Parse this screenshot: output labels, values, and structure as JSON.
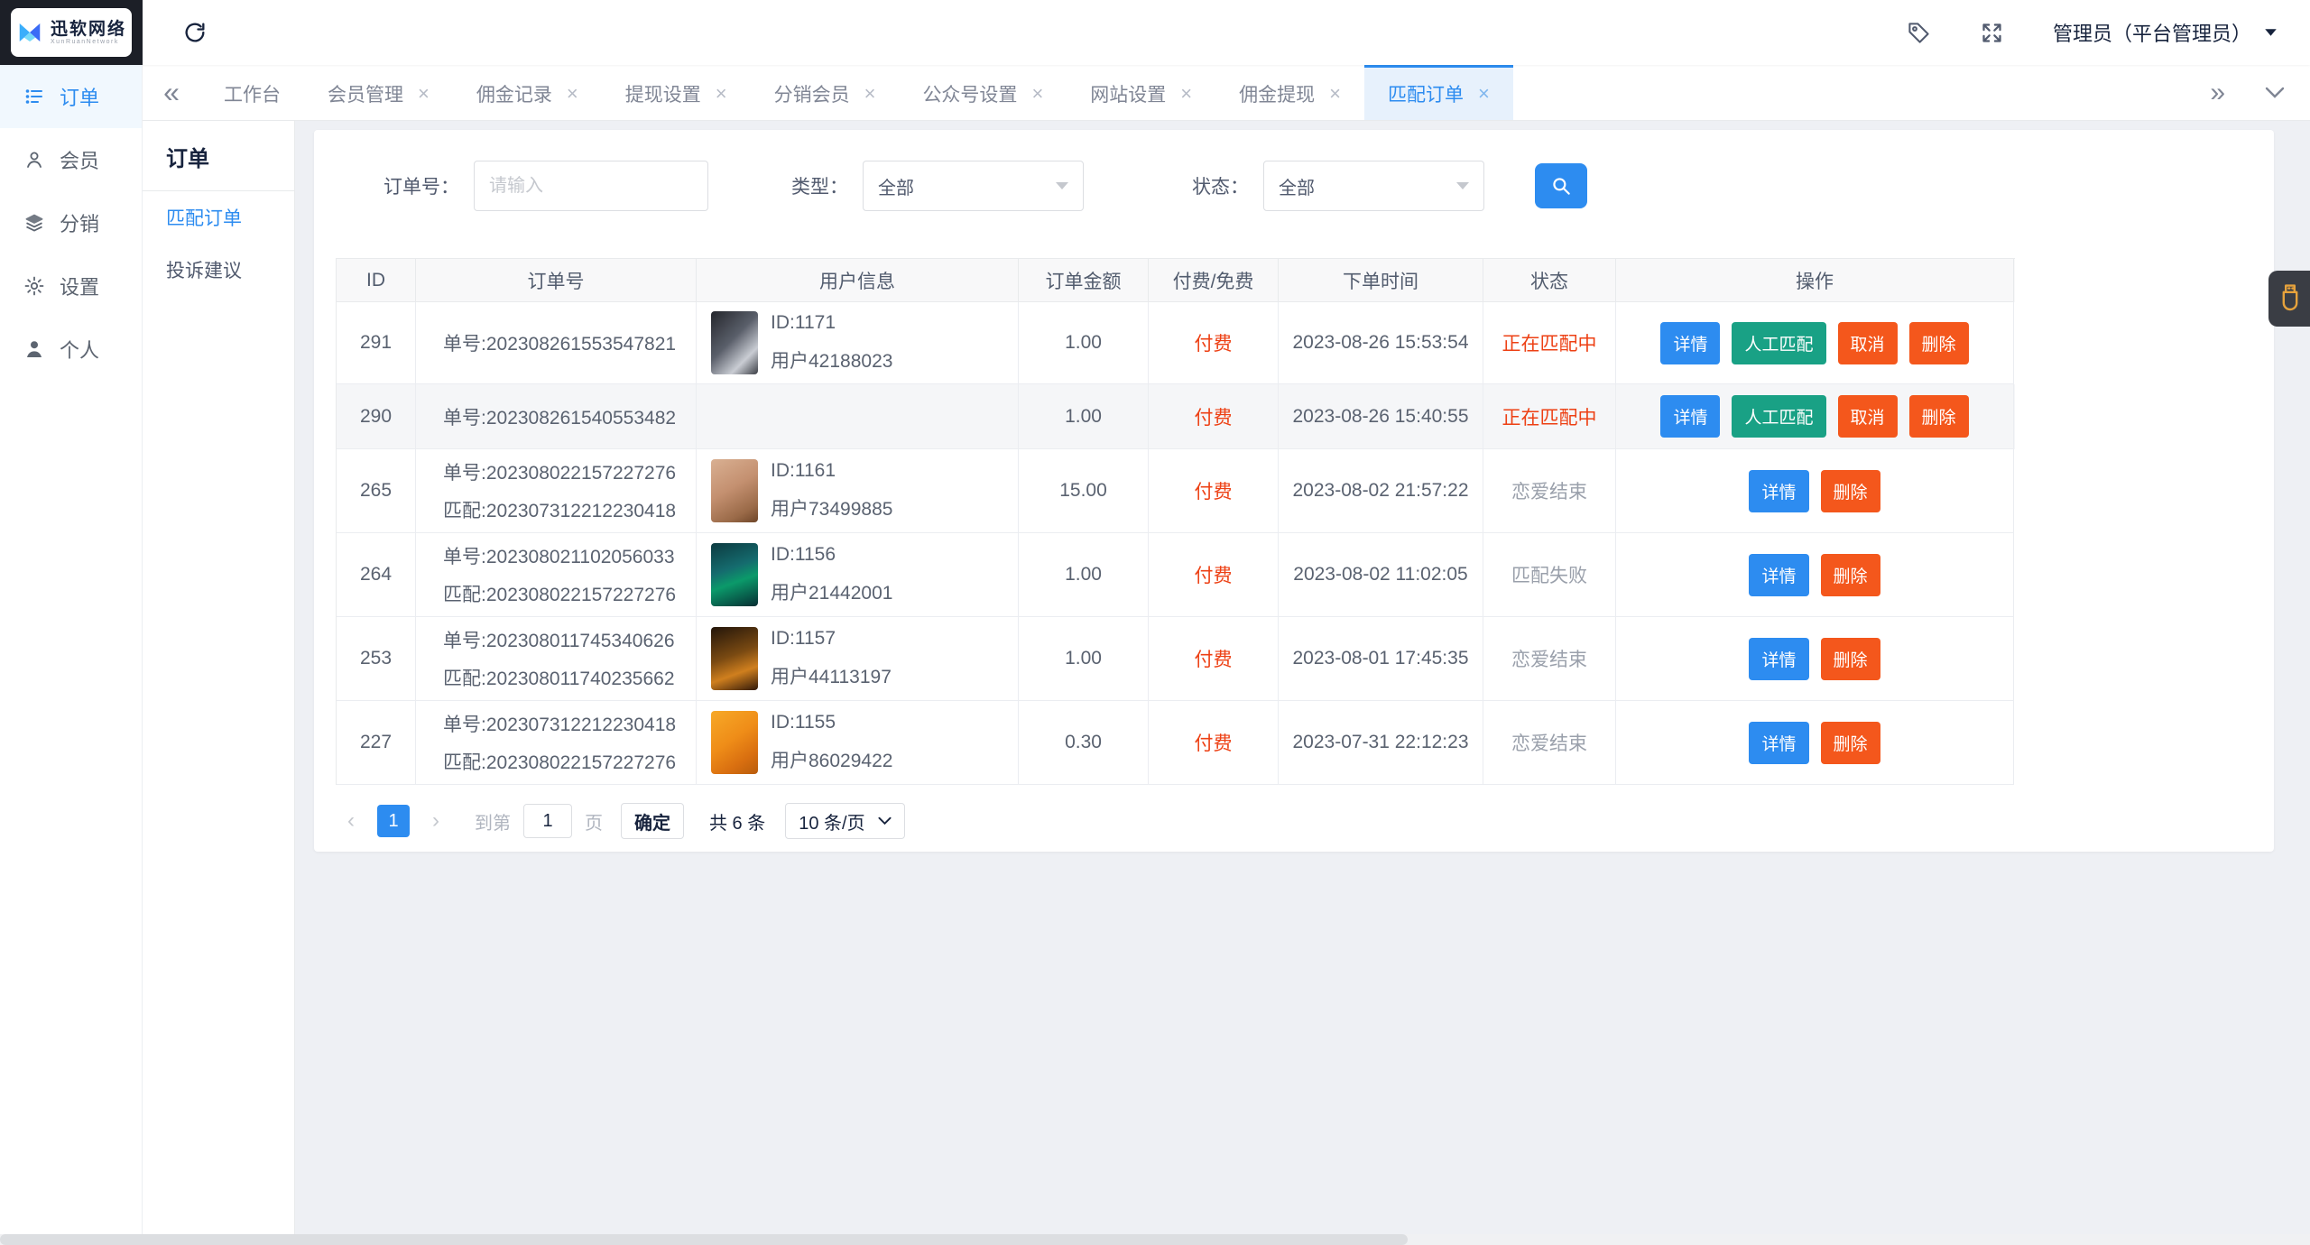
{
  "colors": {
    "accent": "#2d8cf0",
    "danger_text": "#ed4014",
    "green": "#19a185",
    "orange": "#f4571c",
    "dark_header": "#1c1f27"
  },
  "brand": {
    "name": "迅软网络",
    "tagline": "XunRuanNetwork"
  },
  "topbar": {
    "admin": "管理员（平台管理员）"
  },
  "sidebar": {
    "items": [
      {
        "label": "订单",
        "icon": "orders-icon",
        "active": true
      },
      {
        "label": "会员",
        "icon": "member-icon",
        "active": false
      },
      {
        "label": "分销",
        "icon": "distribution-icon",
        "active": false
      },
      {
        "label": "设置",
        "icon": "settings-icon",
        "active": false
      },
      {
        "label": "个人",
        "icon": "profile-icon",
        "active": false
      }
    ]
  },
  "tabbar": {
    "tabs": [
      {
        "label": "工作台",
        "closable": false,
        "active": false
      },
      {
        "label": "会员管理",
        "closable": true,
        "active": false
      },
      {
        "label": "佣金记录",
        "closable": true,
        "active": false
      },
      {
        "label": "提现设置",
        "closable": true,
        "active": false
      },
      {
        "label": "分销会员",
        "closable": true,
        "active": false
      },
      {
        "label": "公众号设置",
        "closable": true,
        "active": false
      },
      {
        "label": "网站设置",
        "closable": true,
        "active": false
      },
      {
        "label": "佣金提现",
        "closable": true,
        "active": false
      },
      {
        "label": "匹配订单",
        "closable": true,
        "active": true
      }
    ]
  },
  "submenu": {
    "title": "订单",
    "items": [
      {
        "label": "匹配订单",
        "active": true
      },
      {
        "label": "投诉建议",
        "active": false
      }
    ]
  },
  "filters": {
    "order_label": "订单号：",
    "order_placeholder": "请输入",
    "type_label": "类型：",
    "type_value": "全部",
    "status_label": "状态：",
    "status_value": "全部"
  },
  "table": {
    "columns": [
      "ID",
      "订单号",
      "用户信息",
      "订单金额",
      "付费/免费",
      "下单时间",
      "状态",
      "操作"
    ],
    "action_labels": {
      "detail": "详情",
      "manual": "人工匹配",
      "cancel": "取消",
      "delete": "删除"
    },
    "action_colors": {
      "detail": "#2d8cf0",
      "manual": "#19a185",
      "cancel": "#f4571c",
      "delete": "#f4571c"
    },
    "rows": [
      {
        "id": "291",
        "orders": [
          "单号:202308261553547821"
        ],
        "user": {
          "uid": "ID:1171",
          "name": "用户42188023",
          "avatar": "avatar-anime"
        },
        "amount": "1.00",
        "fee": "付费",
        "time": "2023-08-26 15:53:54",
        "status": "正在匹配中",
        "status_tone": "red",
        "actions": [
          "detail",
          "manual",
          "cancel",
          "delete"
        ],
        "shaded": false
      },
      {
        "id": "290",
        "orders": [
          "单号:202308261540553482"
        ],
        "user": null,
        "amount": "1.00",
        "fee": "付费",
        "time": "2023-08-26 15:40:55",
        "status": "正在匹配中",
        "status_tone": "red",
        "actions": [
          "detail",
          "manual",
          "cancel",
          "delete"
        ],
        "shaded": true
      },
      {
        "id": "265",
        "orders": [
          "单号:202308022157227276",
          "匹配:202307312212230418"
        ],
        "user": {
          "uid": "ID:1161",
          "name": "用户73499885",
          "avatar": "avatar-dog"
        },
        "amount": "15.00",
        "fee": "付费",
        "time": "2023-08-02 21:57:22",
        "status": "恋爱结束",
        "status_tone": "gray",
        "actions": [
          "detail",
          "delete"
        ],
        "shaded": false
      },
      {
        "id": "264",
        "orders": [
          "单号:202308021102056033",
          "匹配:202308022157227276"
        ],
        "user": {
          "uid": "ID:1156",
          "name": "用户21442001",
          "avatar": "avatar-teal"
        },
        "amount": "1.00",
        "fee": "付费",
        "time": "2023-08-02 11:02:05",
        "status": "匹配失败",
        "status_tone": "gray",
        "actions": [
          "detail",
          "delete"
        ],
        "shaded": false
      },
      {
        "id": "253",
        "orders": [
          "单号:202308011745340626",
          "匹配:202308011740235662"
        ],
        "user": {
          "uid": "ID:1157",
          "name": "用户44113197",
          "avatar": "avatar-monkey"
        },
        "amount": "1.00",
        "fee": "付费",
        "time": "2023-08-01 17:45:35",
        "status": "恋爱结束",
        "status_tone": "gray",
        "actions": [
          "detail",
          "delete"
        ],
        "shaded": false
      },
      {
        "id": "227",
        "orders": [
          "单号:202307312212230418",
          "匹配:202308022157227276"
        ],
        "user": {
          "uid": "ID:1155",
          "name": "用户86029422",
          "avatar": "avatar-garfield"
        },
        "amount": "0.30",
        "fee": "付费",
        "time": "2023-07-31 22:12:23",
        "status": "恋爱结束",
        "status_tone": "gray",
        "actions": [
          "detail",
          "delete"
        ],
        "shaded": false
      }
    ]
  },
  "pagination": {
    "page": "1",
    "goto_prefix": "到第",
    "goto_value": "1",
    "goto_suffix": "页",
    "confirm_label": "确定",
    "total_label": "共 6 条",
    "size_label": "10 条/页"
  }
}
